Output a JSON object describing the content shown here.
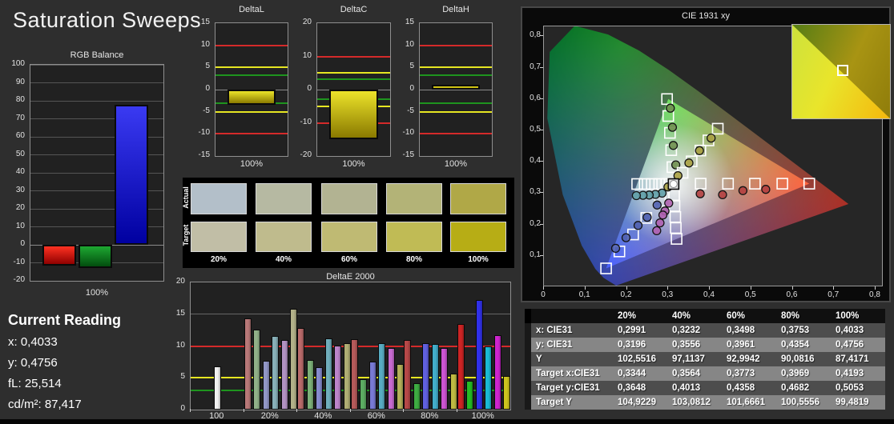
{
  "app": {
    "title": "Saturation Sweeps",
    "background": "#2e2e2e"
  },
  "reading": {
    "title": "Current Reading",
    "lines": [
      "x: 0,4033",
      "y: 0,4756",
      "fL: 25,514",
      "cd/m²: 87,417"
    ]
  },
  "limit_colors": {
    "red": "#d42a2a",
    "yellow": "#e6e622",
    "green": "#1e941e"
  },
  "swatches": {
    "row_labels": [
      "Actual",
      "Target"
    ],
    "col_labels": [
      "20%",
      "40%",
      "60%",
      "80%",
      "100%"
    ],
    "actual_colors": [
      "#b3bfc9",
      "#b6b9a2",
      "#b2b392",
      "#b3b377",
      "#b0a847"
    ],
    "target_colors": [
      "#c1bea6",
      "#bfbb8d",
      "#bfba73",
      "#c0bb55",
      "#b7ad15"
    ]
  },
  "table": {
    "header": [
      "",
      "20%",
      "40%",
      "60%",
      "80%",
      "100%"
    ],
    "rows": [
      {
        "label": "x: CIE31",
        "values": [
          "0,2991",
          "0,3232",
          "0,3498",
          "0,3753",
          "0,4033"
        ]
      },
      {
        "label": "y: CIE31",
        "values": [
          "0,3196",
          "0,3556",
          "0,3961",
          "0,4354",
          "0,4756"
        ]
      },
      {
        "label": "Y",
        "values": [
          "102,5516",
          "97,1137",
          "92,9942",
          "90,0816",
          "87,4171"
        ]
      },
      {
        "label": "Target x:CIE31",
        "values": [
          "0,3344",
          "0,3564",
          "0,3773",
          "0,3969",
          "0,4193"
        ]
      },
      {
        "label": "Target y:CIE31",
        "values": [
          "0,3648",
          "0,4013",
          "0,4358",
          "0,4682",
          "0,5053"
        ]
      },
      {
        "label": "Target Y",
        "values": [
          "104,9229",
          "103,0812",
          "101,6661",
          "100,5556",
          "99,4819"
        ]
      }
    ]
  },
  "chart_data": [
    {
      "id": "rgb_balance",
      "type": "bar",
      "title": "RGB Balance",
      "ylim": [
        -20,
        100
      ],
      "ytick_step": 10,
      "grid": true,
      "categories": [
        "100%"
      ],
      "xlabel": "100%",
      "series": [
        {
          "name": "Red",
          "value": -11.5,
          "color_top": "#ff3222",
          "color_bottom": "#8f0000"
        },
        {
          "name": "Green",
          "value": -13,
          "color_top": "#1ea832",
          "color_bottom": "#024d0e"
        },
        {
          "name": "Blue",
          "value": 78,
          "color_top": "#3a3af2",
          "color_bottom": "#0000a0"
        }
      ]
    },
    {
      "id": "deltaL",
      "type": "bar",
      "title": "DeltaL",
      "ylim": [
        -15,
        15
      ],
      "ytick_step": 5,
      "grid": false,
      "xlabel": "100%",
      "limit_lines": [
        {
          "value": 10,
          "color": "red"
        },
        {
          "value": -10,
          "color": "red"
        },
        {
          "value": 5,
          "color": "yellow"
        },
        {
          "value": -5,
          "color": "yellow"
        },
        {
          "value": 3.2,
          "color": "green"
        },
        {
          "value": -3,
          "color": "green"
        }
      ],
      "series": [
        {
          "name": "DeltaL",
          "value": -3.5,
          "color_top": "#ece32a",
          "color_bottom": "#8a7a00"
        }
      ]
    },
    {
      "id": "deltaC",
      "type": "bar",
      "title": "DeltaC",
      "ylim": [
        -20,
        20
      ],
      "ytick_step": 10,
      "grid": false,
      "xlabel": "100%",
      "limit_lines": [
        {
          "value": 10,
          "color": "red"
        },
        {
          "value": -10,
          "color": "red"
        },
        {
          "value": 5,
          "color": "yellow"
        },
        {
          "value": -5,
          "color": "yellow"
        },
        {
          "value": 3.2,
          "color": "green"
        },
        {
          "value": -3,
          "color": "green"
        }
      ],
      "series": [
        {
          "name": "DeltaC",
          "value": -15,
          "color_top": "#ece32a",
          "color_bottom": "#8a7a00"
        }
      ]
    },
    {
      "id": "deltaH",
      "type": "bar",
      "title": "DeltaH",
      "ylim": [
        -15,
        15
      ],
      "ytick_step": 5,
      "grid": false,
      "xlabel": "100%",
      "limit_lines": [
        {
          "value": 10,
          "color": "red"
        },
        {
          "value": -10,
          "color": "red"
        },
        {
          "value": 5,
          "color": "yellow"
        },
        {
          "value": -5,
          "color": "yellow"
        },
        {
          "value": 3.2,
          "color": "green"
        },
        {
          "value": -3,
          "color": "green"
        }
      ],
      "series": [
        {
          "name": "DeltaH",
          "value": 1,
          "color_top": "#ece32a",
          "color_bottom": "#b8a800"
        }
      ]
    },
    {
      "id": "deltaE2000",
      "type": "grouped-bar",
      "title": "DeltaE 2000",
      "ylim": [
        0,
        20
      ],
      "yticks": [
        0,
        5,
        10,
        15,
        20
      ],
      "gridlines": [
        5,
        10,
        15
      ],
      "limit_lines": [
        {
          "value": 10,
          "color": "red"
        },
        {
          "value": 5,
          "color": "yellow"
        },
        {
          "value": 3,
          "color": "green"
        }
      ],
      "groups": [
        {
          "label": "100",
          "values": [
            6.8
          ],
          "colors": [
            "#f0f0f0"
          ]
        },
        {
          "label": "20%",
          "values": [
            14.4,
            12.6,
            7.7,
            11.6,
            11.0,
            15.9
          ],
          "colors": [
            "#b87878",
            "#91b088",
            "#9196c6",
            "#88b0b8",
            "#b292c2",
            "#b2b088"
          ]
        },
        {
          "label": "40%",
          "values": [
            12.8,
            7.8,
            6.7,
            11.2,
            10.1,
            10.4
          ],
          "colors": [
            "#b86a6a",
            "#7cb078",
            "#868ace",
            "#70aebc",
            "#bc84ca",
            "#b0ae74"
          ]
        },
        {
          "label": "60%",
          "values": [
            11.1,
            4.8,
            7.6,
            10.5,
            9.7,
            7.2
          ],
          "colors": [
            "#b65a5a",
            "#5cac62",
            "#787ad4",
            "#58acc2",
            "#c66ad0",
            "#b4b05a"
          ]
        },
        {
          "label": "80%",
          "values": [
            10.9,
            4.2,
            10.5,
            10.3,
            9.7,
            5.7
          ],
          "colors": [
            "#b64848",
            "#3eac42",
            "#6060e0",
            "#42adca",
            "#cc54d2",
            "#bebb42"
          ]
        },
        {
          "label": "100%",
          "values": [
            13.4,
            4.5,
            17.2,
            10.0,
            11.7,
            5.3
          ],
          "colors": [
            "#cc2424",
            "#24bc24",
            "#3030e8",
            "#1abad4",
            "#ce24ce",
            "#ccc41e"
          ]
        }
      ]
    },
    {
      "id": "cie",
      "type": "scatter",
      "title": "CIE 1931 xy",
      "xlim": [
        0,
        0.82
      ],
      "ylim": [
        0,
        0.835
      ],
      "xticks": [
        0,
        0.1,
        0.2,
        0.3,
        0.4,
        0.5,
        0.6,
        0.7,
        0.8
      ],
      "yticks": [
        0.1,
        0.2,
        0.3,
        0.4,
        0.5,
        0.6,
        0.7,
        0.8
      ],
      "gamut_triangle": {
        "red": [
          0.64,
          0.33
        ],
        "green": [
          0.3,
          0.6
        ],
        "blue": [
          0.15,
          0.06
        ]
      },
      "white_point": [
        0.3127,
        0.329
      ],
      "sweeps": [
        {
          "name": "red",
          "marker_color": "#b24040",
          "targets": [
            [
              0.378,
              0.33
            ],
            [
              0.444,
              0.33
            ],
            [
              0.509,
              0.33
            ],
            [
              0.575,
              0.33
            ],
            [
              0.64,
              0.33
            ]
          ],
          "measured": [
            [
              0.377,
              0.298
            ],
            [
              0.431,
              0.295
            ],
            [
              0.48,
              0.308
            ],
            [
              0.535,
              0.312
            ]
          ]
        },
        {
          "name": "green",
          "marker_color": "#6f8f4f",
          "targets": [
            [
              0.31,
              0.383
            ],
            [
              0.307,
              0.437
            ],
            [
              0.304,
              0.492
            ],
            [
              0.3,
              0.546
            ],
            [
              0.297,
              0.6
            ]
          ],
          "measured": [
            [
              0.318,
              0.39
            ],
            [
              0.312,
              0.452
            ],
            [
              0.31,
              0.51
            ],
            [
              0.305,
              0.571
            ]
          ]
        },
        {
          "name": "blue",
          "marker_color": "#5060b0",
          "targets": [
            [
              0.28,
              0.275
            ],
            [
              0.247,
              0.221
            ],
            [
              0.215,
              0.168
            ],
            [
              0.182,
              0.114
            ],
            [
              0.15,
              0.06
            ]
          ],
          "measured": [
            [
              0.273,
              0.262
            ],
            [
              0.249,
              0.223
            ],
            [
              0.227,
              0.197
            ],
            [
              0.198,
              0.158
            ],
            [
              0.173,
              0.124
            ]
          ]
        },
        {
          "name": "cyan",
          "marker_color": "#60a0a8",
          "targets": [
            [
              0.295,
              0.329
            ],
            [
              0.278,
              0.329
            ],
            [
              0.26,
              0.329
            ],
            [
              0.243,
              0.329
            ],
            [
              0.225,
              0.329
            ]
          ],
          "measured": [
            [
              0.285,
              0.3
            ],
            [
              0.269,
              0.296
            ],
            [
              0.254,
              0.294
            ],
            [
              0.239,
              0.293
            ],
            [
              0.223,
              0.292
            ]
          ]
        },
        {
          "name": "magenta",
          "marker_color": "#b060b0",
          "targets": [
            [
              0.314,
              0.294
            ],
            [
              0.315,
              0.259
            ],
            [
              0.317,
              0.224
            ],
            [
              0.318,
              0.189
            ],
            [
              0.32,
              0.154
            ]
          ],
          "measured": [
            [
              0.301,
              0.268
            ],
            [
              0.292,
              0.243
            ],
            [
              0.287,
              0.23
            ],
            [
              0.28,
              0.205
            ],
            [
              0.272,
              0.18
            ]
          ]
        },
        {
          "name": "yellow",
          "marker_color": "#a8a040",
          "targets": [
            [
              0.3344,
              0.3648
            ],
            [
              0.3564,
              0.4013
            ],
            [
              0.3773,
              0.4358
            ],
            [
              0.3969,
              0.4682
            ],
            [
              0.4193,
              0.5053
            ]
          ],
          "measured": [
            [
              0.2991,
              0.3196
            ],
            [
              0.3232,
              0.3556
            ],
            [
              0.3498,
              0.3961
            ],
            [
              0.3753,
              0.4354
            ],
            [
              0.4033,
              0.4756
            ]
          ]
        }
      ],
      "inset": {
        "marker": [
          0.52,
          0.49
        ]
      }
    }
  ]
}
